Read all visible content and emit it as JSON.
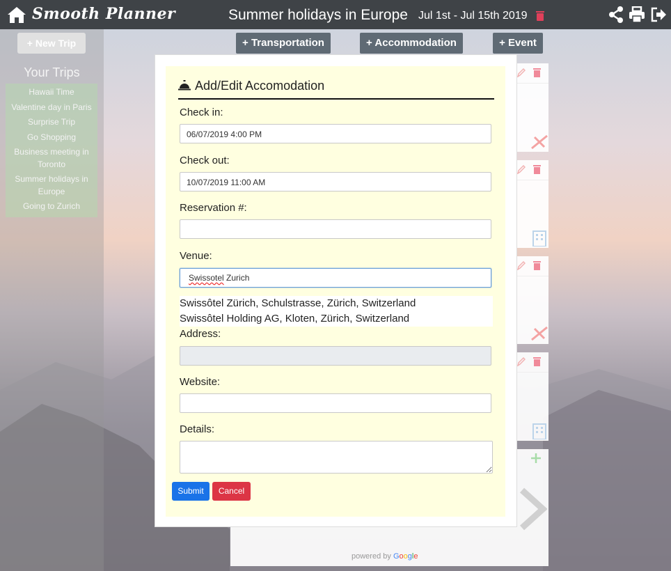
{
  "header": {
    "brand": "Smooth Planner",
    "trip_title": "Summer holidays in Europe",
    "trip_dates": "Jul 1st - Jul 15th 2019"
  },
  "sidebar": {
    "new_trip_label": "+ New Trip",
    "your_trips_heading": "Your Trips",
    "trips": [
      "Hawaii Time",
      "Valentine day in Paris",
      "Surprise Trip",
      "Go Shopping",
      "Business meeting in Toronto",
      "Summer holidays in Europe",
      "Going to Zurich"
    ]
  },
  "toolbar": {
    "transportation_label": "+ Transportation",
    "accommodation_label": "+ Accommodation",
    "event_label": "+ Event"
  },
  "modal": {
    "title": "Add/Edit Accomodation",
    "checkin_label": "Check in:",
    "checkin_value": "06/07/2019 4:00 PM",
    "checkout_label": "Check out:",
    "checkout_value": "10/07/2019 11:00 AM",
    "reservation_label": "Reservation #:",
    "reservation_value": "",
    "venue_label": "Venue:",
    "venue_value_part1": "Swissotel",
    "venue_value_part2": " Zurich",
    "suggestions": [
      "Swissôtel Zürich, Schulstrasse, Zürich, Switzerland",
      "Swissôtel Holding AG, Kloten, Zürich, Switzerland"
    ],
    "address_label": "Address:",
    "address_value": "",
    "website_label": "Website:",
    "website_value": "",
    "details_label": "Details:",
    "details_value": "",
    "submit_label": "Submit",
    "cancel_label": "Cancel"
  },
  "footer": {
    "powered_by": "powered by"
  },
  "colors": {
    "topbar": "#3f4347",
    "modal_bg": "#ffffe0",
    "submit": "#1a73e8",
    "cancel": "#dc3545",
    "trash": "#e0405a"
  }
}
